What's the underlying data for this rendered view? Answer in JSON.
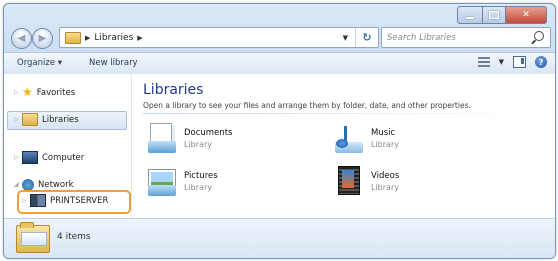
{
  "window": {
    "caption": {
      "minimize": "minimize-icon",
      "maximize": "maximize-icon",
      "close": "✕"
    }
  },
  "address_bar": {
    "breadcrumb": [
      "Libraries"
    ],
    "separator": "▶",
    "search_placeholder": "Search Libraries"
  },
  "toolbar": {
    "organize_label": "Organize ▾",
    "new_library_label": "New library"
  },
  "nav_pane": {
    "items": [
      {
        "label": "Favorites",
        "icon": "star-icon"
      },
      {
        "label": "Libraries",
        "icon": "library-icon",
        "selected": true
      },
      {
        "label": "Computer",
        "icon": "computer-icon"
      },
      {
        "label": "Network",
        "icon": "network-icon"
      },
      {
        "label": "PRINTSERVER",
        "icon": "server-icon",
        "highlighted": true
      }
    ]
  },
  "content": {
    "title": "Libraries",
    "subtitle": "Open a library to see your files and arrange them by folder, date, and other properties.",
    "libraries": [
      {
        "name": "Documents",
        "type": "Library",
        "icon": "documents-library-icon"
      },
      {
        "name": "Music",
        "type": "Library",
        "icon": "music-library-icon"
      },
      {
        "name": "Pictures",
        "type": "Library",
        "icon": "pictures-library-icon"
      },
      {
        "name": "Videos",
        "type": "Library",
        "icon": "videos-library-icon"
      }
    ]
  },
  "details": {
    "item_count": "4 items"
  },
  "colors": {
    "title_blue": "#1e3a8c",
    "highlight_orange": "#f29f36",
    "close_red": "#c14a35"
  }
}
